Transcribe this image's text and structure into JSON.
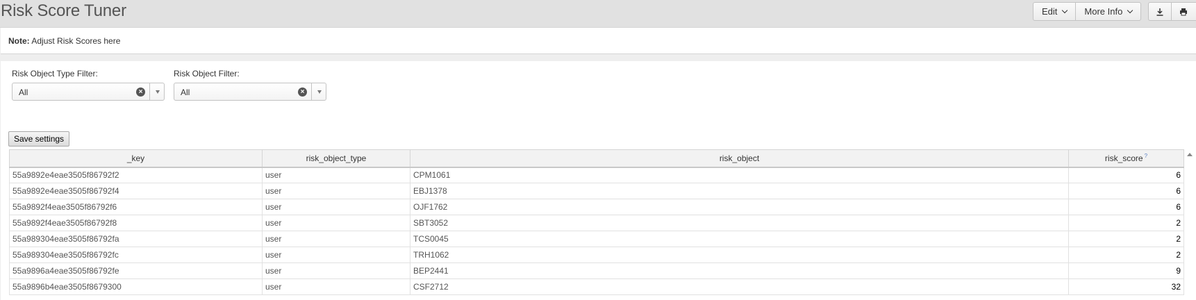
{
  "header": {
    "title": "Risk Score Tuner",
    "edit_label": "Edit",
    "more_info_label": "More Info",
    "download_icon": "download-icon",
    "print_icon": "print-icon"
  },
  "note": {
    "label": "Note:",
    "text": "Adjust Risk Scores here"
  },
  "filters": [
    {
      "label": "Risk Object Type Filter:",
      "value": "All"
    },
    {
      "label": "Risk Object Filter:",
      "value": "All"
    }
  ],
  "save_label": "Save settings",
  "table": {
    "columns": [
      "_key",
      "risk_object_type",
      "risk_object",
      "risk_score"
    ],
    "rows": [
      [
        "55a9892e4eae3505f86792f2",
        "user",
        "CPM1061",
        "6"
      ],
      [
        "55a9892e4eae3505f86792f4",
        "user",
        "EBJ1378",
        "6"
      ],
      [
        "55a9892f4eae3505f86792f6",
        "user",
        "OJF1762",
        "6"
      ],
      [
        "55a9892f4eae3505f86792f8",
        "user",
        "SBT3052",
        "2"
      ],
      [
        "55a989304eae3505f86792fa",
        "user",
        "TCS0045",
        "2"
      ],
      [
        "55a989304eae3505f86792fc",
        "user",
        "TRH1062",
        "2"
      ],
      [
        "55a9896a4eae3505f86792fe",
        "user",
        "BEP2441",
        "9"
      ],
      [
        "55a9896b4eae3505f8679300",
        "user",
        "CSF2712",
        "32"
      ]
    ]
  }
}
